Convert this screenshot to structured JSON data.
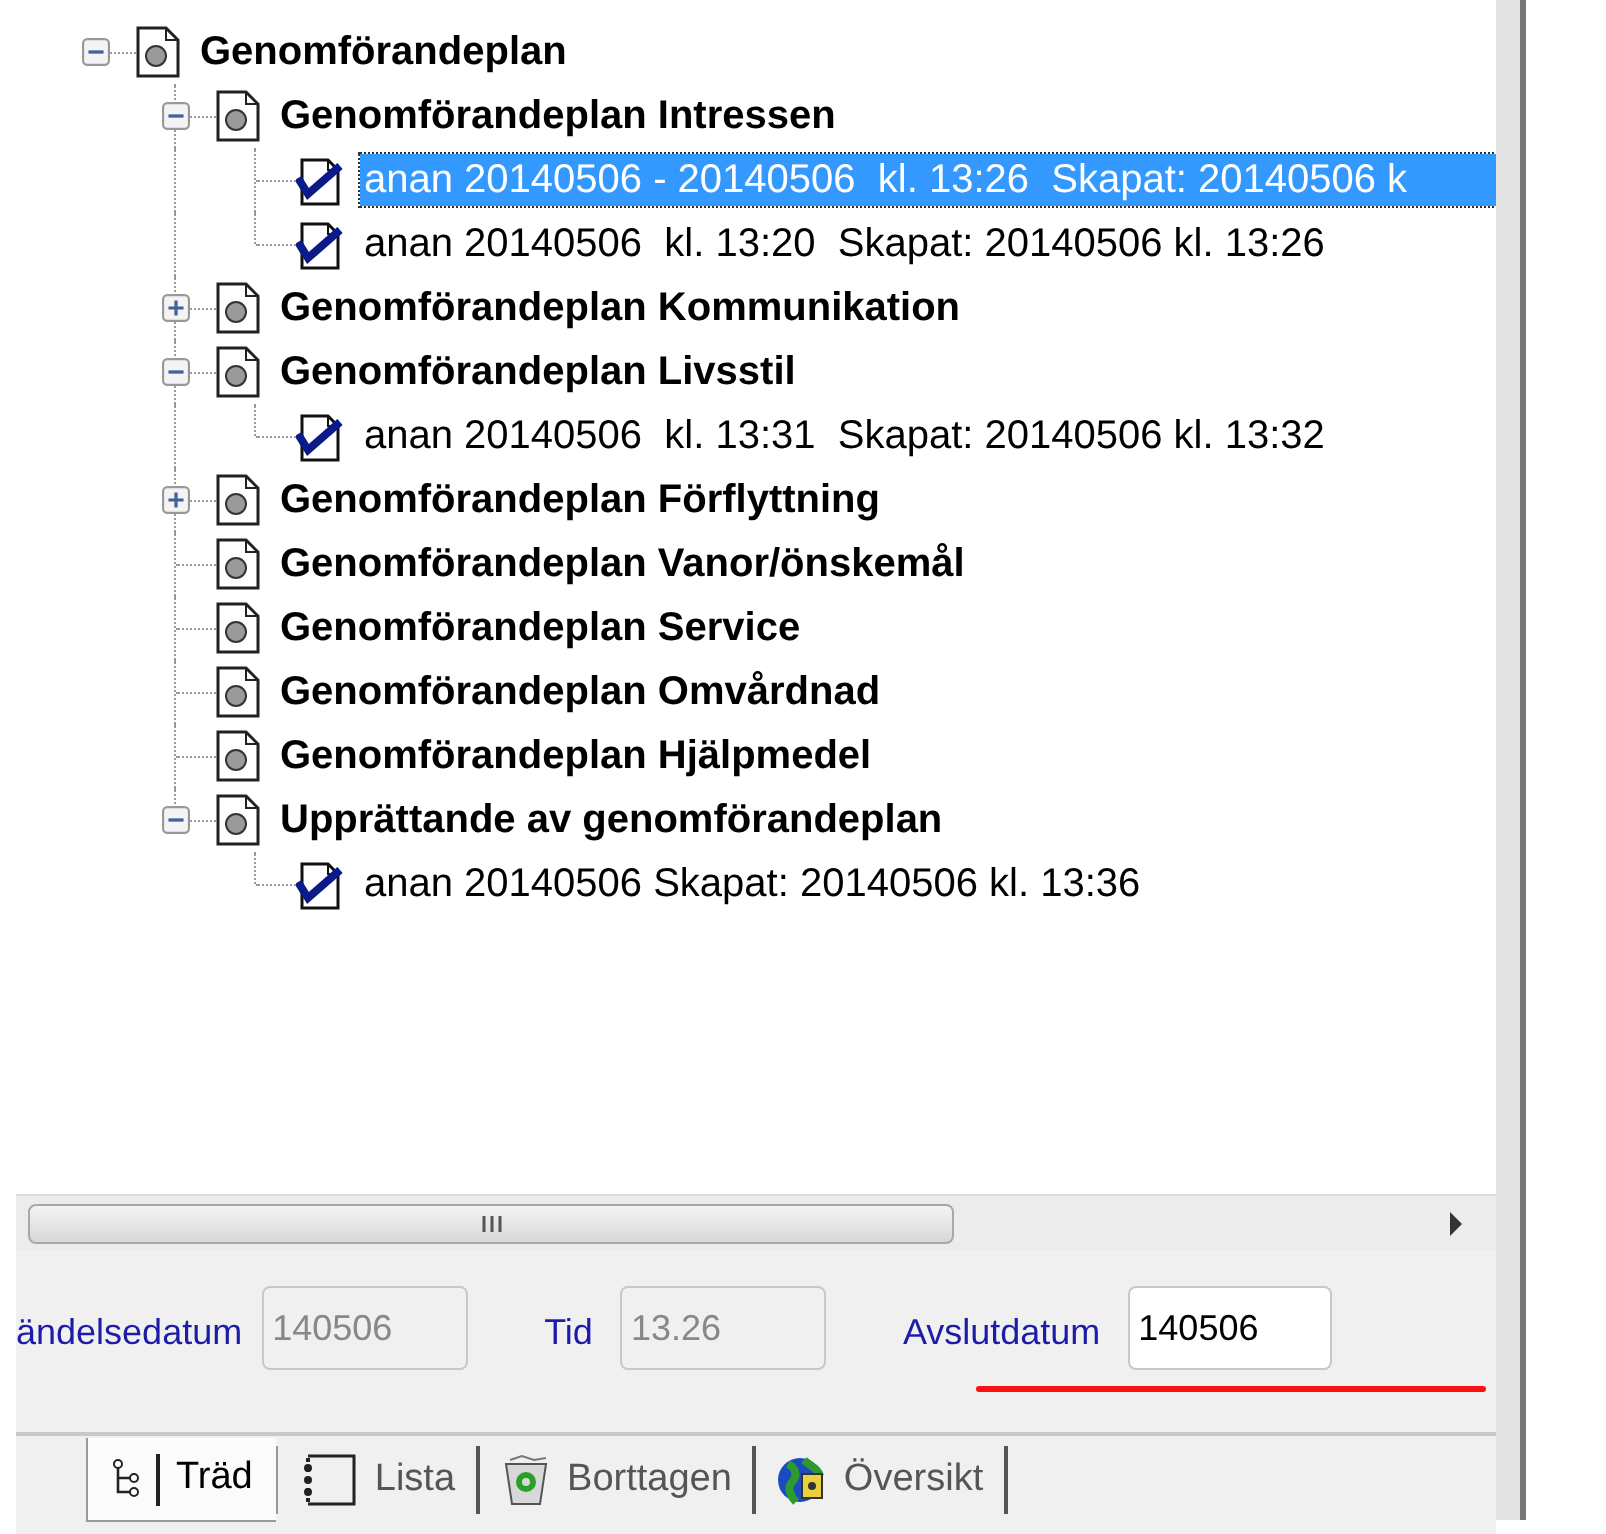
{
  "tree": [
    {
      "label": "Genomförandeplan",
      "kind": "plan",
      "expanded": true,
      "selected": false,
      "children": [
        {
          "label": "Genomförandeplan Intressen",
          "kind": "plan",
          "expanded": true,
          "selected": false,
          "children": [
            {
              "label": "anan 20140506 - 20140506  kl. 13:26  Skapat: 20140506 k",
              "kind": "entry",
              "selected": true
            },
            {
              "label": "anan 20140506  kl. 13:20  Skapat: 20140506 kl. 13:26",
              "kind": "entry",
              "selected": false
            }
          ]
        },
        {
          "label": "Genomförandeplan Kommunikation",
          "kind": "plan",
          "expanded": false,
          "selected": false
        },
        {
          "label": "Genomförandeplan Livsstil",
          "kind": "plan",
          "expanded": true,
          "selected": false,
          "children": [
            {
              "label": "anan 20140506  kl. 13:31  Skapat: 20140506 kl. 13:32",
              "kind": "entry",
              "selected": false
            }
          ]
        },
        {
          "label": "Genomförandeplan Förflyttning",
          "kind": "plan",
          "expanded": false,
          "selected": false
        },
        {
          "label": "Genomförandeplan Vanor/önskemål",
          "kind": "plan",
          "selected": false
        },
        {
          "label": "Genomförandeplan Service",
          "kind": "plan",
          "selected": false
        },
        {
          "label": "Genomförandeplan Omvårdnad",
          "kind": "plan",
          "selected": false
        },
        {
          "label": "Genomförandeplan Hjälpmedel",
          "kind": "plan",
          "selected": false
        },
        {
          "label": "Upprättande av genomförandeplan",
          "kind": "plan",
          "expanded": true,
          "selected": false,
          "children": [
            {
              "label": "anan 20140506 Skapat: 20140506 kl. 13:36",
              "kind": "entry",
              "selected": false
            }
          ]
        }
      ]
    }
  ],
  "form": {
    "fields": [
      {
        "label": "ändelsedatum",
        "value": "140506",
        "disabled": true
      },
      {
        "label": "Tid",
        "value": "13.26",
        "disabled": true
      },
      {
        "label": "Avslutdatum",
        "value": "140506",
        "disabled": false
      }
    ]
  },
  "tabs": [
    {
      "label": "Träd",
      "kind": "tree",
      "selected": true
    },
    {
      "label": "Lista",
      "kind": "list",
      "selected": false
    },
    {
      "label": "Borttagen",
      "kind": "bin",
      "selected": false
    },
    {
      "label": "Översikt",
      "kind": "globe",
      "selected": false
    }
  ]
}
